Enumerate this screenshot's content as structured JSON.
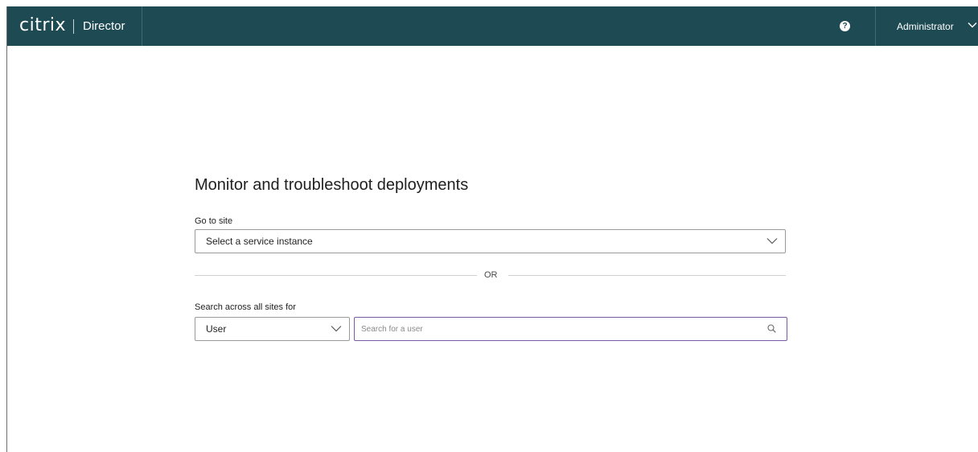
{
  "header": {
    "logo_text": "citrix",
    "product_name": "Director",
    "help_icon": "?",
    "user_name": "Administrator"
  },
  "main": {
    "heading": "Monitor and troubleshoot deployments",
    "site_label": "Go to site",
    "site_select_value": "Select a service instance",
    "divider_text": "OR",
    "search_label": "Search across all sites for",
    "search_type_value": "User",
    "search_placeholder": "Search for a user"
  },
  "colors": {
    "header_bg": "#1e4a53",
    "search_border": "#7a5aa6"
  },
  "icons": {
    "help": "question-circle-icon",
    "user_menu": "chevron-down-icon",
    "site_dropdown": "chevron-down-icon",
    "search_type_dropdown": "chevron-down-icon",
    "search": "magnifier-icon"
  }
}
